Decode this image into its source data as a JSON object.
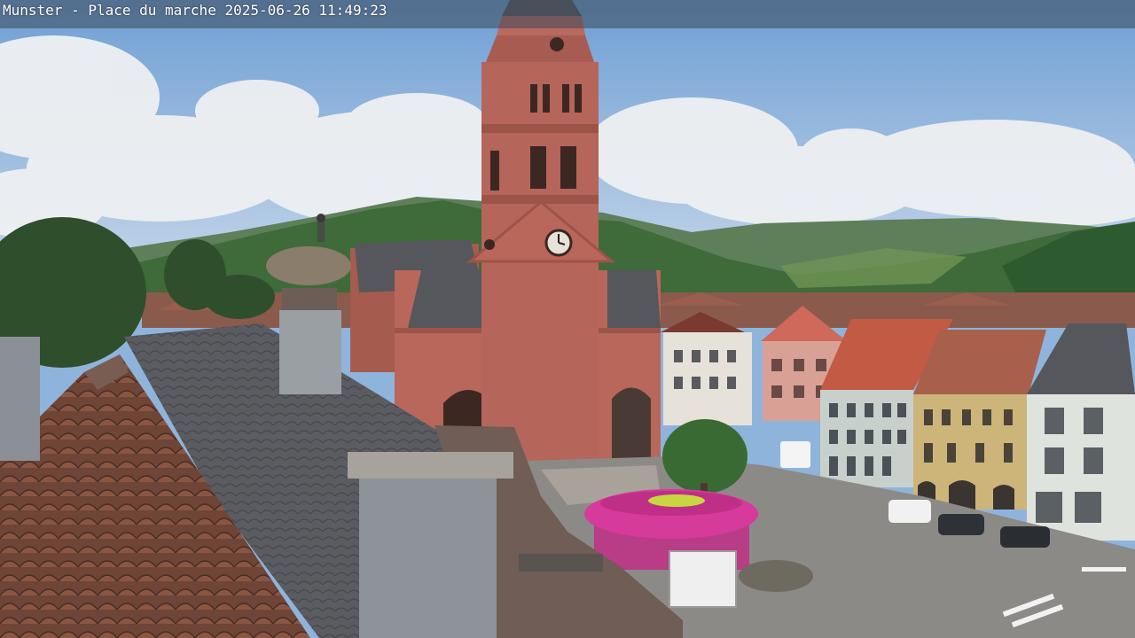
{
  "overlay": {
    "caption": "Munster - Place du marche 2025-06-26 11:49:23"
  },
  "scene": {
    "subject": "webcam view of a market square with a red sandstone church tower",
    "colors": {
      "sky": "#8fb4dc",
      "sandstone": "#b8675a",
      "roof_slate": "#55575c",
      "roof_tile": "#7a4a3a",
      "hills": "#3f6a3a",
      "pink_kiosk": "#d63a9a",
      "yellow_facade": "#cdb57a",
      "white_facade": "#e6e2da"
    }
  }
}
